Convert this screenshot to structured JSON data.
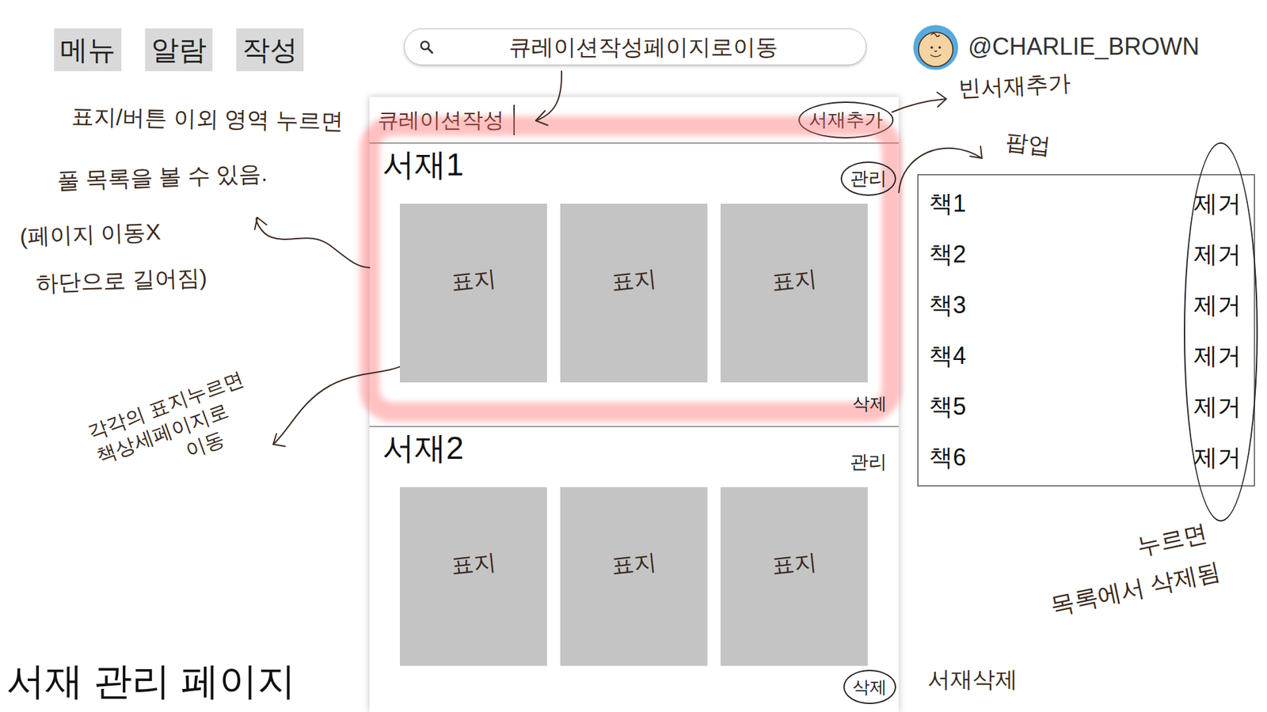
{
  "page_title": "서재 관리 페이지",
  "nav": [
    {
      "label": "메뉴"
    },
    {
      "label": "알람"
    },
    {
      "label": "작성"
    }
  ],
  "search": {
    "note": "큐레이션작성페이지로이동"
  },
  "user": {
    "handle": "@CHARLIE_BROWN"
  },
  "panel": {
    "create_link": "큐레이션작성",
    "add_shelf": {
      "label": "서재추가",
      "circled": true
    },
    "shelves": [
      {
        "title": "서재1",
        "manage": {
          "label": "관리",
          "circled": true
        },
        "covers": [
          "표지",
          "표지",
          "표지"
        ],
        "delete": {
          "label": "삭제",
          "circled": false
        },
        "highlighted": true
      },
      {
        "title": "서재2",
        "manage": {
          "label": "관리",
          "circled": false
        },
        "covers": [
          "표지",
          "표지",
          "표지"
        ],
        "delete": {
          "label": "삭제",
          "circled": true
        },
        "highlighted": false
      }
    ]
  },
  "popup": {
    "actions_circled": true,
    "items": [
      {
        "title": "책1",
        "action": "제거"
      },
      {
        "title": "책2",
        "action": "제거"
      },
      {
        "title": "책3",
        "action": "제거"
      },
      {
        "title": "책4",
        "action": "제거"
      },
      {
        "title": "책5",
        "action": "제거"
      },
      {
        "title": "책6",
        "action": "제거"
      }
    ]
  },
  "annotations": {
    "add_shelf": "빈서재추가",
    "popup": "팝업",
    "remove": [
      "누르면",
      "목록에서 삭제됨"
    ],
    "delete_shelf": "서재삭제",
    "shelf_area": [
      "표지/버튼 이외 영역 누르면",
      "풀 목록을 볼 수 있음.",
      "(페이지 이동X",
      "하단으로 길어짐)"
    ],
    "cover": [
      "각각의 표지누르면",
      "책상세페이지로",
      "이동"
    ]
  }
}
